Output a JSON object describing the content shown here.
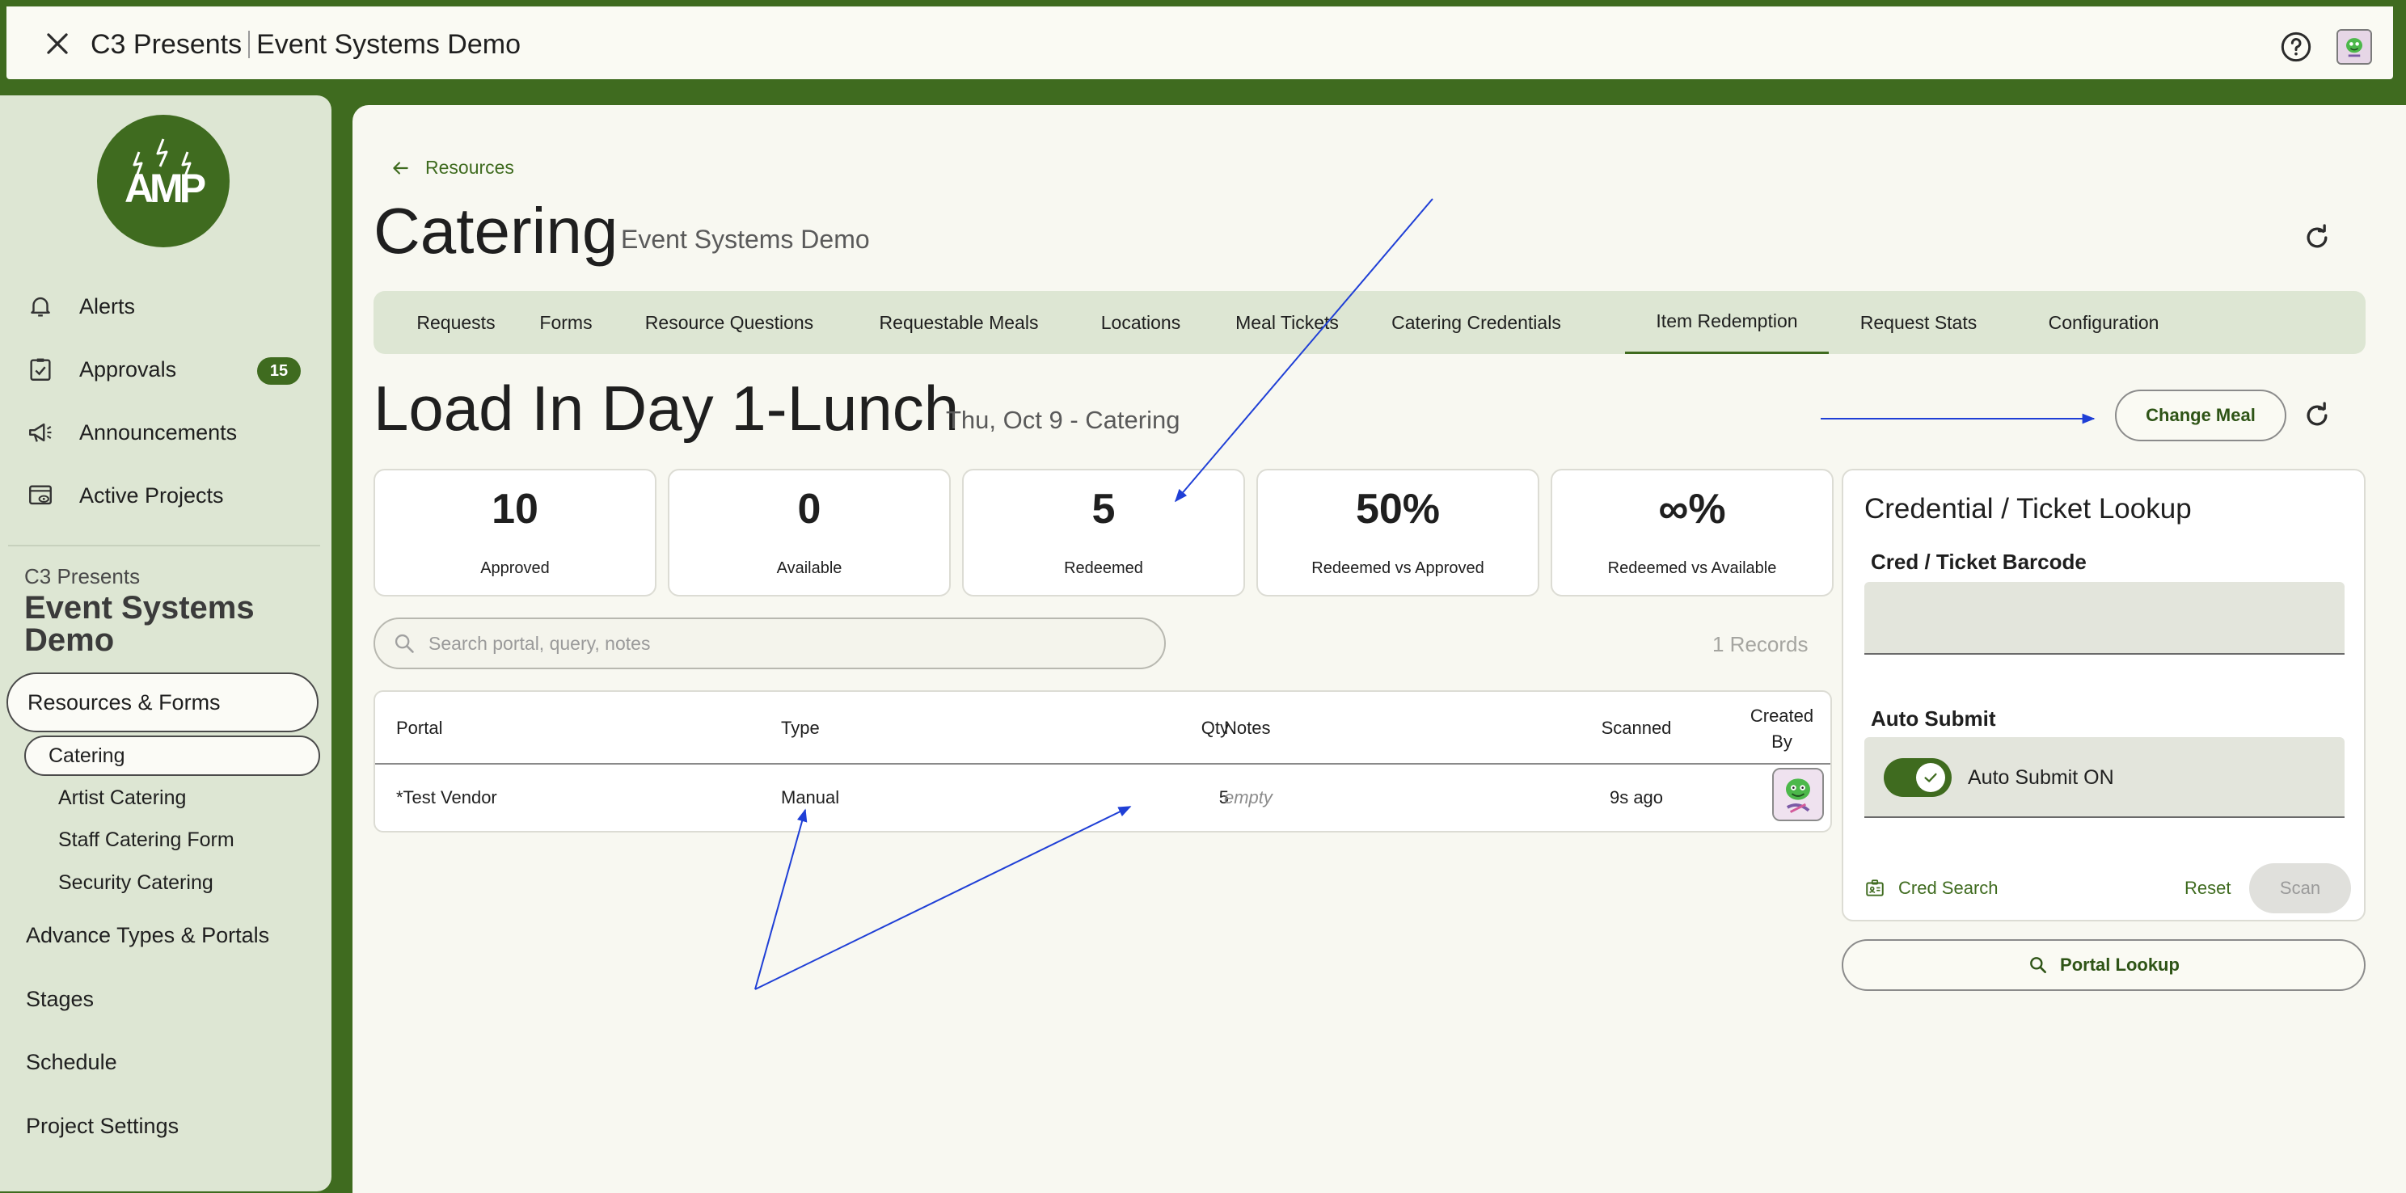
{
  "topbar": {
    "org": "C3 Presents",
    "project": "Event Systems Demo"
  },
  "colors": {
    "brand_green": "#3f6b1f",
    "sidebar_bg": "#dde6d3",
    "content_bg": "#f8f8f1",
    "annotation_blue": "#1f3fd6"
  },
  "sidebar": {
    "logo_text": "AMP",
    "nav": [
      {
        "label": "Alerts",
        "icon": "bell-icon"
      },
      {
        "label": "Approvals",
        "icon": "clipboard-check-icon",
        "badge": "15"
      },
      {
        "label": "Announcements",
        "icon": "megaphone-icon"
      },
      {
        "label": "Active Projects",
        "icon": "project-view-icon"
      }
    ],
    "project_org": "C3 Presents",
    "project_name": "Event Systems Demo",
    "resources_forms": "Resources & Forms",
    "sub_items": [
      "Catering",
      "Artist Catering",
      "Staff Catering Form",
      "Security Catering"
    ],
    "sections": [
      "Advance Types & Portals",
      "Stages",
      "Schedule",
      "Project Settings"
    ]
  },
  "main": {
    "breadcrumb": "Resources",
    "title": "Catering",
    "subtitle": "Event Systems Demo",
    "tabs": [
      "Requests",
      "Forms",
      "Resource Questions",
      "Requestable Meals",
      "Locations",
      "Meal Tickets",
      "Catering Credentials",
      "Item Redemption",
      "Request Stats",
      "Configuration"
    ],
    "active_tab": "Item Redemption",
    "meal_title": "Load In Day 1-Lunch",
    "meal_subtitle": "Thu, Oct 9 - Catering",
    "change_meal": "Change Meal",
    "stats": [
      {
        "value": "10",
        "label": "Approved"
      },
      {
        "value": "0",
        "label": "Available"
      },
      {
        "value": "5",
        "label": "Redeemed"
      },
      {
        "value": "50%",
        "label": "Redeemed vs Approved"
      },
      {
        "value": "∞%",
        "label": "Redeemed vs Available"
      }
    ],
    "search_placeholder": "Search portal, query, notes",
    "records": "1 Records",
    "table": {
      "headers": {
        "portal": "Portal",
        "type": "Type",
        "qty": "Qty",
        "notes": "Notes",
        "scanned": "Scanned",
        "created_by_1": "Created",
        "created_by_2": "By"
      },
      "rows": [
        {
          "portal": "*Test Vendor",
          "type": "Manual",
          "qty": "5",
          "notes": "empty",
          "scanned": "9s ago"
        }
      ]
    }
  },
  "lookup": {
    "title": "Credential / Ticket Lookup",
    "barcode_label": "Cred / Ticket Barcode",
    "auto_submit_label": "Auto Submit",
    "auto_submit_state": "Auto Submit ON",
    "cred_search": "Cred Search",
    "reset": "Reset",
    "scan": "Scan",
    "portal_lookup": "Portal Lookup"
  }
}
